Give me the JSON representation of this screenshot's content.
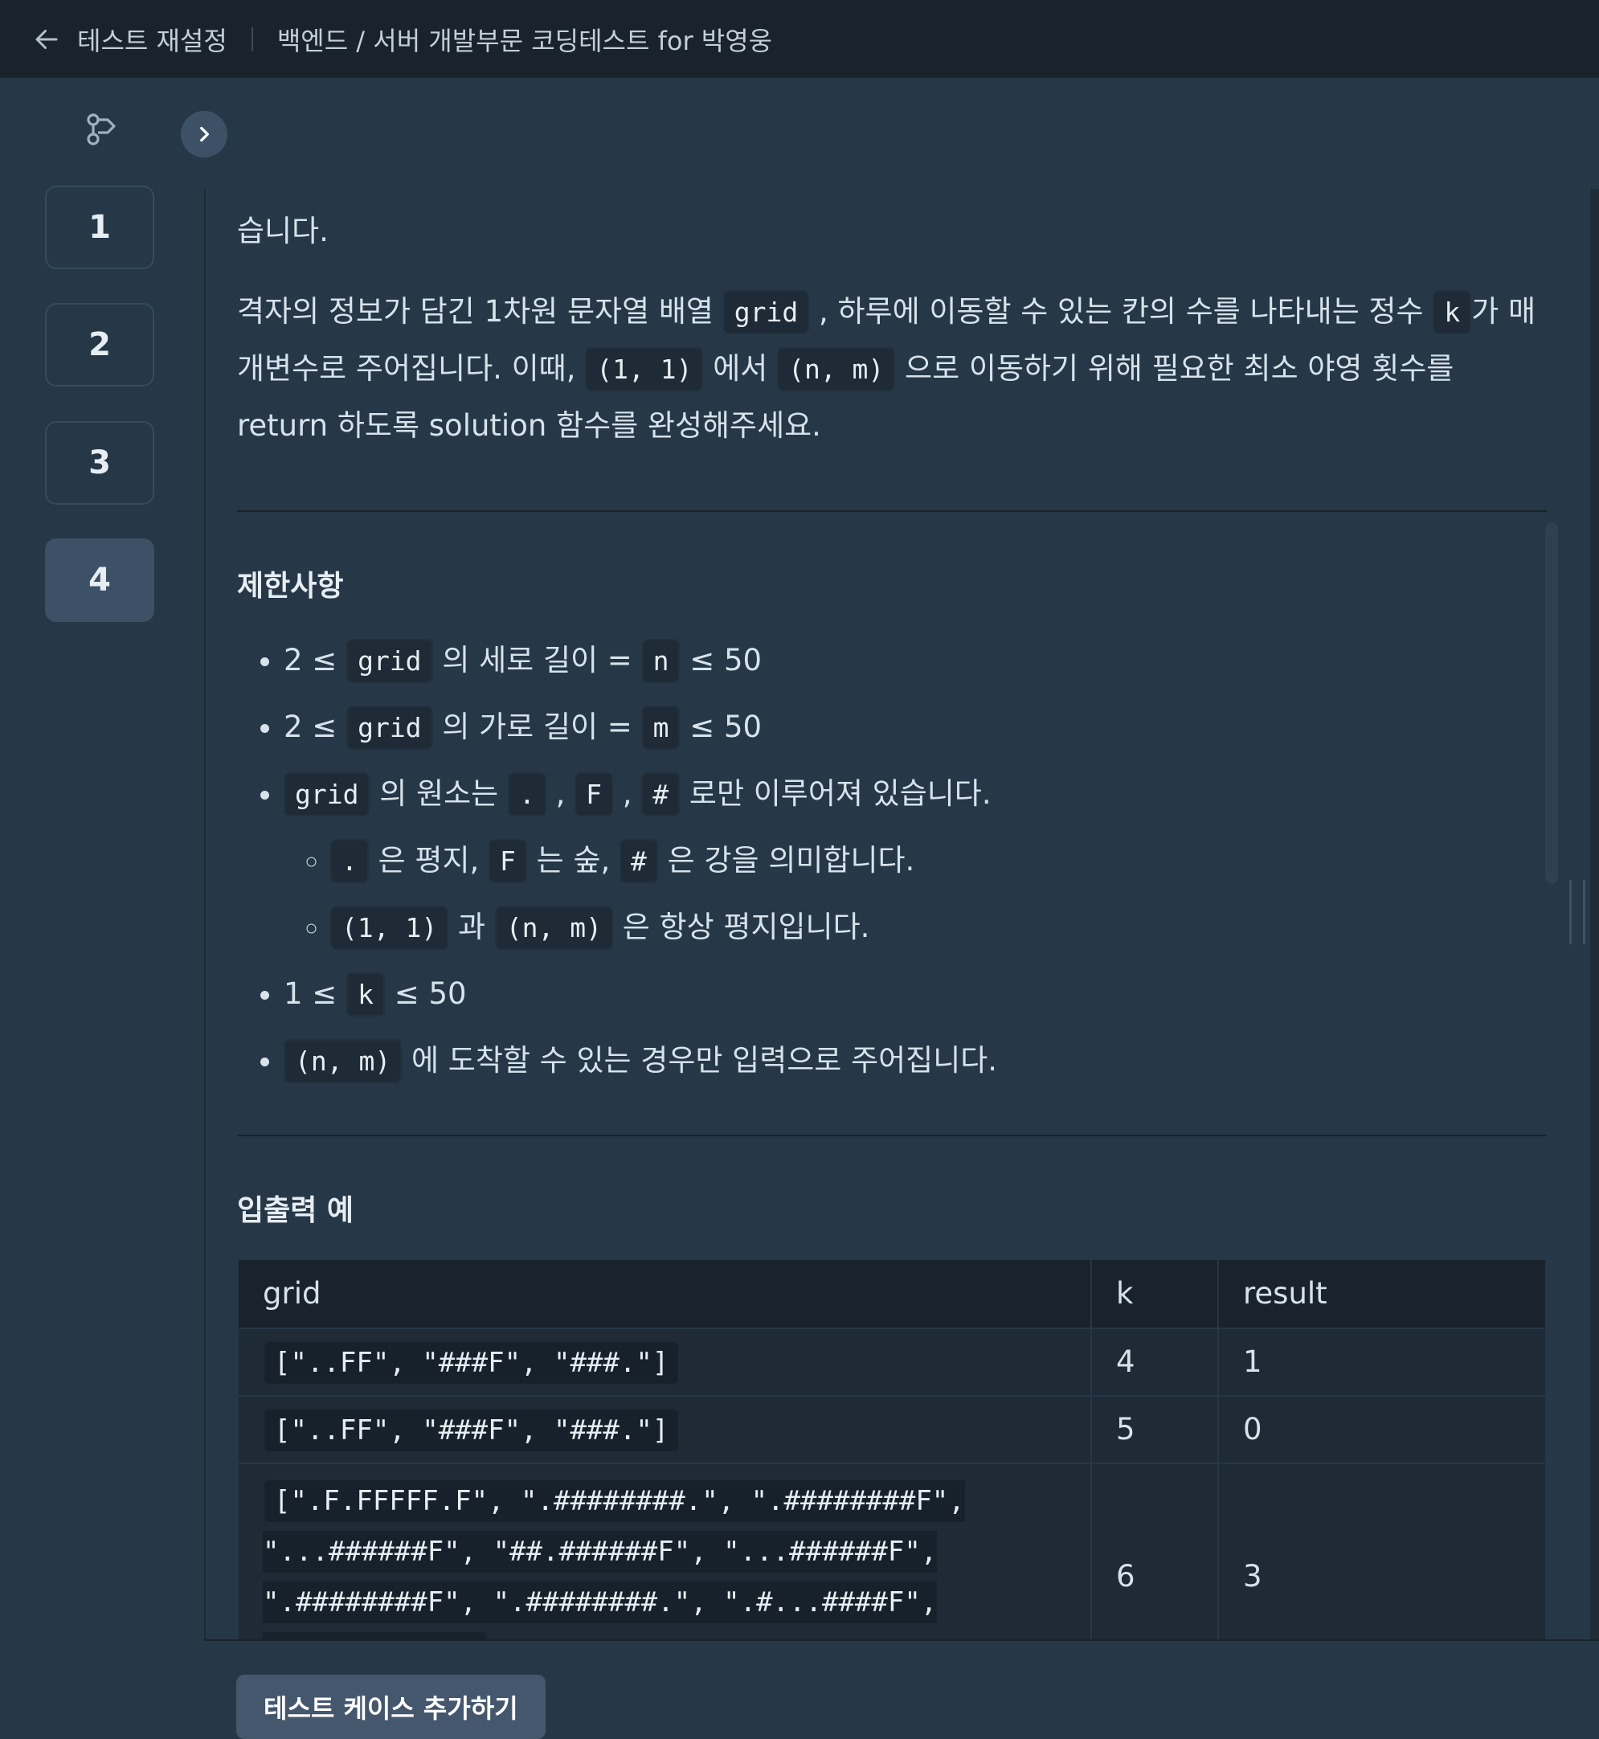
{
  "topbar": {
    "back_label": "테스트 재설정",
    "breadcrumb": "백엔드 / 서버 개발부문 코딩테스트 for 박영웅"
  },
  "sidebar": {
    "questions": [
      "1",
      "2",
      "3",
      "4"
    ],
    "active": "4"
  },
  "problem": {
    "clipped_line": "…습니다.",
    "clipped_tail": "습니다.",
    "desc": {
      "p1_a": "격자의 정보가 담긴 1차원 문자열 배열 ",
      "p1_code_grid": "grid",
      "p1_b": " , 하루에 이동할 수 있는 칸의 수를 나타내는 정수 ",
      "p1_code_k": "k",
      "p1_c": "가 매개변수로 주어집니다. 이때, ",
      "p1_code_start": "(1, 1)",
      "p1_d": " 에서 ",
      "p1_code_end": "(n, m)",
      "p1_e": " 으로 이동하기 위해 필요한 최소 야영 횟수를 return 하도록 solution 함수를 완성해주세요."
    },
    "constraints_title": "제한사항",
    "constraints": {
      "c1_a": "2 ≤ ",
      "c1_code": "grid",
      "c1_b": " 의 세로 길이 = ",
      "c1_code2": "n",
      "c1_c": " ≤ 50",
      "c2_a": "2 ≤ ",
      "c2_code": "grid",
      "c2_b": " 의 가로 길이 = ",
      "c2_code2": "m",
      "c2_c": " ≤ 50",
      "c3_code": "grid",
      "c3_a": " 의 원소는 ",
      "c3_code_dot": ".",
      "c3_comma1": " , ",
      "c3_code_f": "F",
      "c3_comma2": " , ",
      "c3_code_hash": "#",
      "c3_b": " 로만 이루어져 있습니다.",
      "c3s1_code_dot": ".",
      "c3s1_a": " 은 평지, ",
      "c3s1_code_f": "F",
      "c3s1_b": " 는 숲, ",
      "c3s1_code_hash": "#",
      "c3s1_c": " 은 강을 의미합니다.",
      "c3s2_code1": "(1, 1)",
      "c3s2_a": " 과 ",
      "c3s2_code2": "(n, m)",
      "c3s2_b": " 은 항상 평지입니다.",
      "c4_a": "1 ≤ ",
      "c4_code": "k",
      "c4_b": " ≤ 50",
      "c5_code": "(n, m)",
      "c5_a": " 에 도착할 수 있는 경우만 입력으로 주어집니다."
    },
    "io_title": "입출력 예",
    "io_table": {
      "headers": [
        "grid",
        "k",
        "result"
      ],
      "rows": [
        {
          "grid": "[\"..FF\", \"###F\", \"###.\"]",
          "k": "4",
          "result": "1"
        },
        {
          "grid": "[\"..FF\", \"###F\", \"###.\"]",
          "k": "5",
          "result": "0"
        },
        {
          "grid": "[\".F.FFFFF.F\", \".########.\", \".########F\", \"...######F\", \"##.######F\", \"...######F\", \".########F\", \".########.\", \".#...####F\", \"...#......\"]",
          "k": "6",
          "result": "3"
        }
      ]
    }
  },
  "footer": {
    "add_testcase_label": "테스트 케이스 추가하기"
  }
}
